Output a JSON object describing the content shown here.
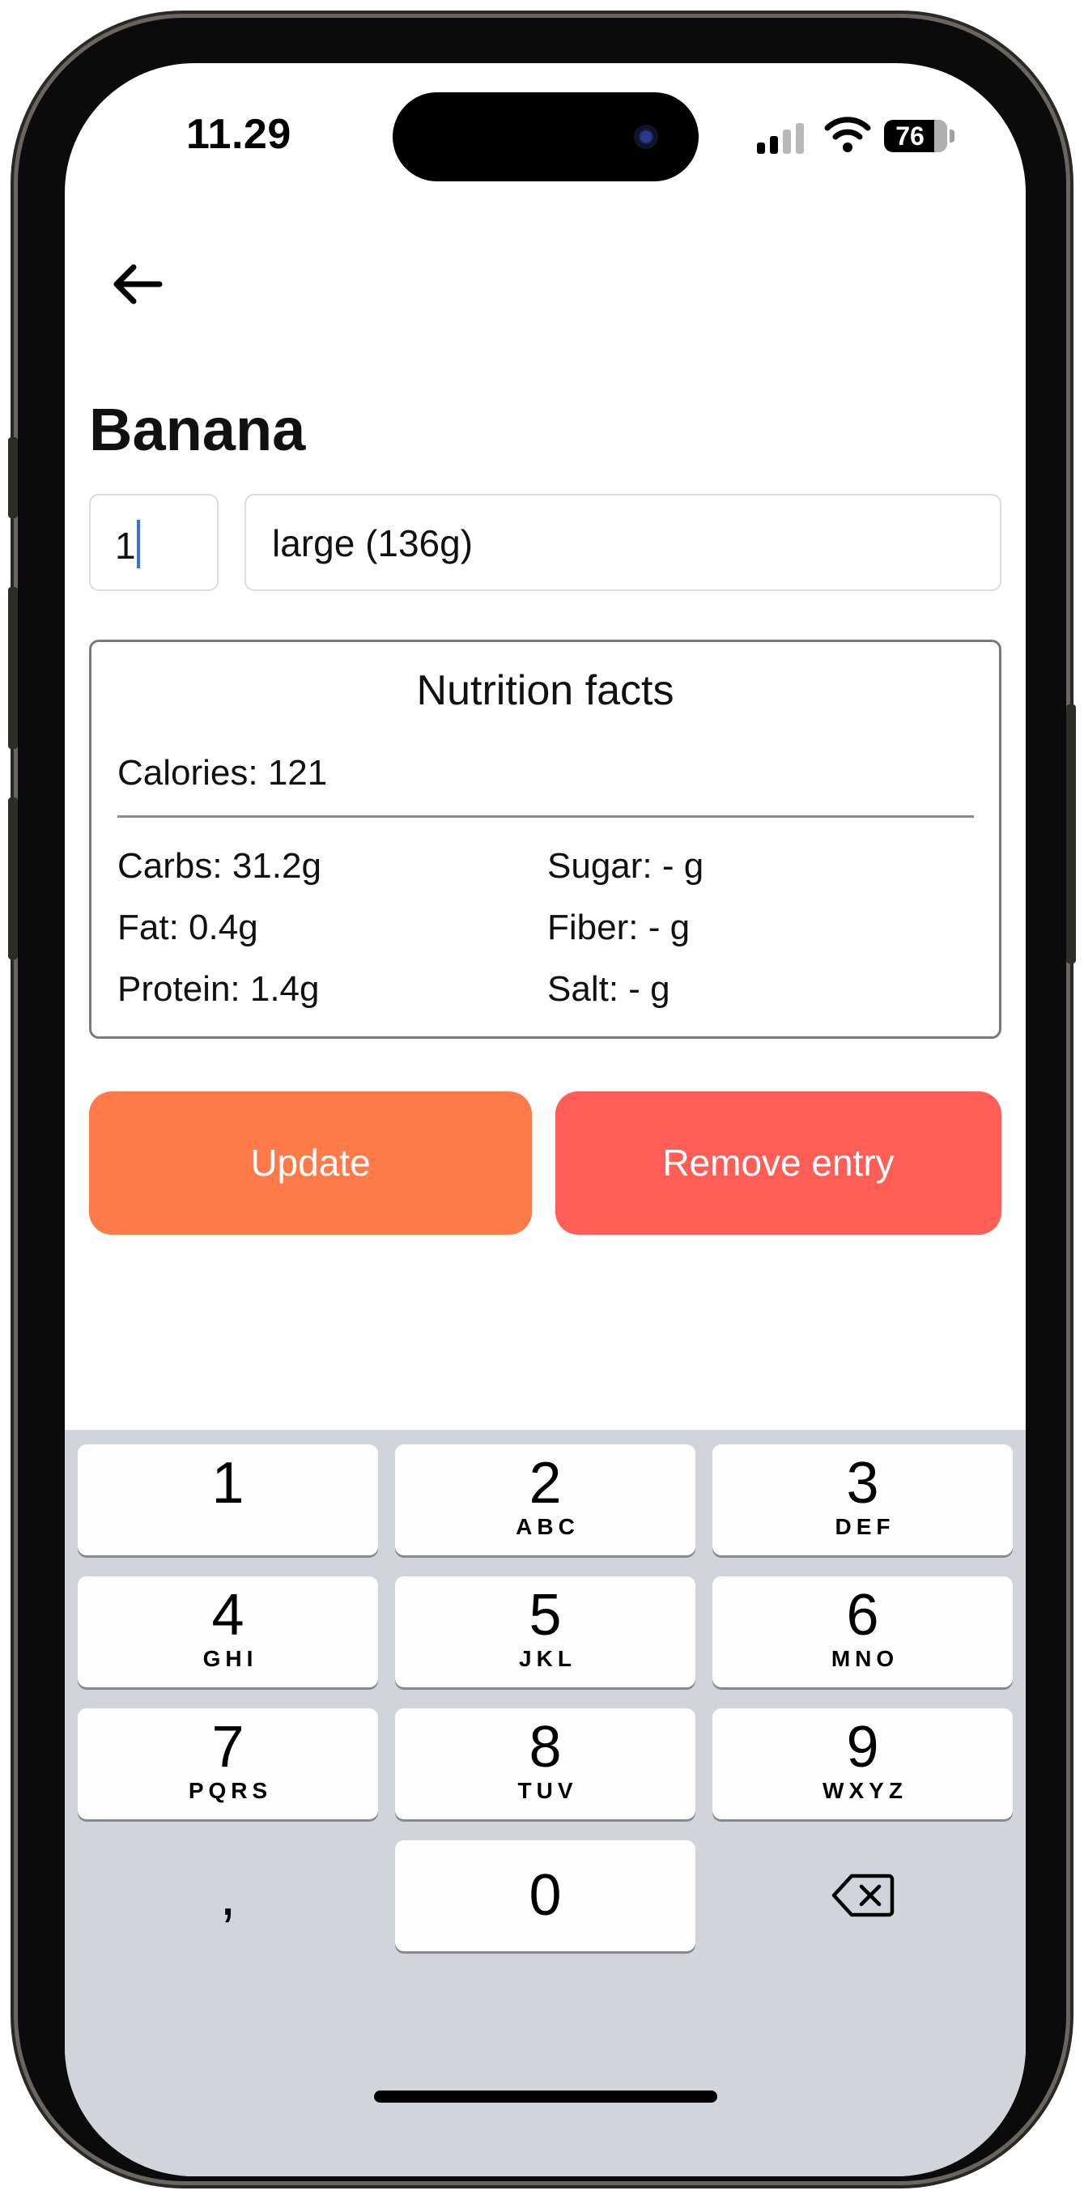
{
  "status_bar": {
    "time": "11.29",
    "battery": "76"
  },
  "header": {
    "back_icon": "arrow-left-icon"
  },
  "food": {
    "name": "Banana"
  },
  "portion": {
    "quantity": "1",
    "unit": "large (136g)"
  },
  "nutrition": {
    "title": "Nutrition facts",
    "calories": "Calories: 121",
    "carbs": "Carbs: 31.2g",
    "fat": "Fat: 0.4g",
    "protein": "Protein: 1.4g",
    "sugar": "Sugar: - g",
    "fiber": "Fiber: - g",
    "salt": "Salt: - g"
  },
  "actions": {
    "update": "Update",
    "remove": "Remove entry"
  },
  "colors": {
    "update": "#ff7a48",
    "remove": "#ff5e57",
    "keyboard_bg": "#d1d4db"
  },
  "keyboard": {
    "keys": [
      {
        "digit": "1",
        "letters": ""
      },
      {
        "digit": "2",
        "letters": "ABC"
      },
      {
        "digit": "3",
        "letters": "DEF"
      },
      {
        "digit": "4",
        "letters": "GHI"
      },
      {
        "digit": "5",
        "letters": "JKL"
      },
      {
        "digit": "6",
        "letters": "MNO"
      },
      {
        "digit": "7",
        "letters": "PQRS"
      },
      {
        "digit": "8",
        "letters": "TUV"
      },
      {
        "digit": "9",
        "letters": "WXYZ"
      }
    ],
    "comma": ",",
    "zero": "0",
    "delete_icon": "backspace-icon"
  }
}
